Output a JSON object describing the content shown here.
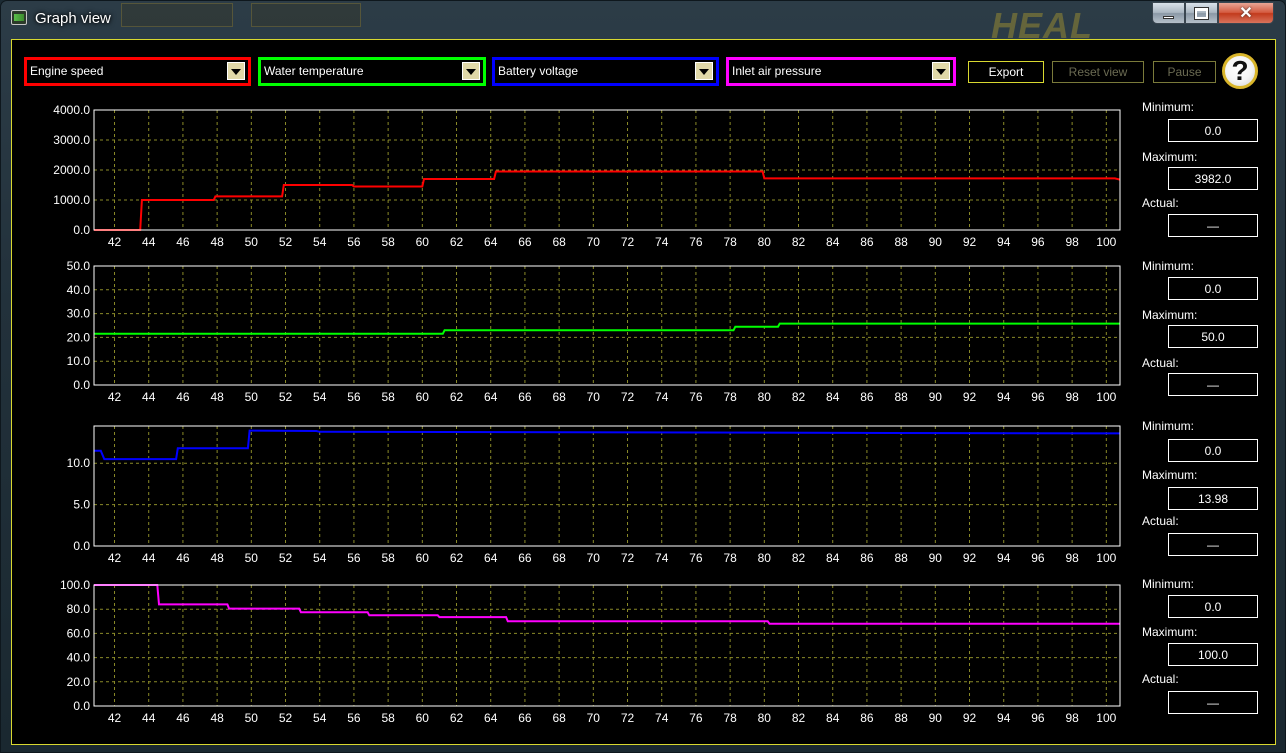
{
  "window": {
    "title": "Graph view",
    "brand_logo": "HEAL"
  },
  "toolbar": {
    "selects": [
      {
        "label": "Engine speed",
        "color": "#ff0000"
      },
      {
        "label": "Water temperature",
        "color": "#00ff00"
      },
      {
        "label": "Battery voltage",
        "color": "#0000ff"
      },
      {
        "label": "Inlet air pressure",
        "color": "#ff00ff"
      }
    ],
    "export_label": "Export",
    "reset_label": "Reset view",
    "pause_label": "Pause",
    "help_label": "?"
  },
  "side_labels": {
    "minimum": "Minimum:",
    "maximum": "Maximum:",
    "actual": "Actual:"
  },
  "panels": [
    {
      "minimum": "0.0",
      "maximum": "3982.0",
      "actual": "—"
    },
    {
      "minimum": "0.0",
      "maximum": "50.0",
      "actual": "—"
    },
    {
      "minimum": "0.0",
      "maximum": "13.98",
      "actual": "—"
    },
    {
      "minimum": "0.0",
      "maximum": "100.0",
      "actual": "—"
    }
  ],
  "chart_data": [
    {
      "type": "line",
      "series": [
        {
          "color": "#ff0000",
          "points": [
            [
              40.8,
              0
            ],
            [
              43.5,
              0
            ],
            [
              43.6,
              1000
            ],
            [
              47.8,
              1000
            ],
            [
              47.9,
              1120
            ],
            [
              51.8,
              1120
            ],
            [
              51.9,
              1500
            ],
            [
              55.9,
              1500
            ],
            [
              56.0,
              1450
            ],
            [
              60.0,
              1450
            ],
            [
              60.1,
              1700
            ],
            [
              64.2,
              1700
            ],
            [
              64.3,
              1950
            ],
            [
              79.9,
              1950
            ],
            [
              80.0,
              1720
            ],
            [
              100.5,
              1720
            ],
            [
              100.8,
              1680
            ]
          ]
        }
      ],
      "x_range": [
        40.8,
        100.8
      ],
      "y_range": [
        0,
        4000
      ],
      "y_ticks": [
        "0.0",
        "1000.0",
        "2000.0",
        "3000.0",
        "4000.0"
      ],
      "x_ticks": [
        "42",
        "44",
        "46",
        "48",
        "50",
        "52",
        "54",
        "56",
        "58",
        "60",
        "62",
        "64",
        "66",
        "68",
        "70",
        "72",
        "74",
        "76",
        "78",
        "80",
        "82",
        "84",
        "86",
        "88",
        "90",
        "92",
        "94",
        "96",
        "98",
        "100"
      ],
      "grid": true
    },
    {
      "type": "line",
      "series": [
        {
          "color": "#00ff00",
          "points": [
            [
              40.8,
              21.5
            ],
            [
              61.2,
              21.5
            ],
            [
              61.3,
              23.0
            ],
            [
              78.2,
              23.0
            ],
            [
              78.3,
              24.5
            ],
            [
              80.8,
              24.5
            ],
            [
              80.9,
              25.8
            ],
            [
              100.8,
              25.8
            ]
          ]
        }
      ],
      "x_range": [
        40.8,
        100.8
      ],
      "y_range": [
        0,
        50
      ],
      "y_ticks": [
        "0.0",
        "10.0",
        "20.0",
        "30.0",
        "40.0",
        "50.0"
      ],
      "x_ticks": [
        "42",
        "44",
        "46",
        "48",
        "50",
        "52",
        "54",
        "56",
        "58",
        "60",
        "62",
        "64",
        "66",
        "68",
        "70",
        "72",
        "74",
        "76",
        "78",
        "80",
        "82",
        "84",
        "86",
        "88",
        "90",
        "92",
        "94",
        "96",
        "98",
        "100"
      ],
      "grid": true
    },
    {
      "type": "line",
      "series": [
        {
          "color": "#0000ff",
          "points": [
            [
              40.8,
              11.5
            ],
            [
              41.2,
              11.5
            ],
            [
              41.4,
              10.5
            ],
            [
              45.6,
              10.5
            ],
            [
              45.7,
              11.8
            ],
            [
              49.8,
              11.8
            ],
            [
              49.9,
              13.95
            ],
            [
              53.8,
              13.9
            ],
            [
              54.0,
              13.8
            ],
            [
              100.8,
              13.6
            ]
          ]
        }
      ],
      "x_range": [
        40.8,
        100.8
      ],
      "y_range": [
        0,
        14.5
      ],
      "y_ticks": [
        "0.0",
        "5.0",
        "10.0"
      ],
      "x_ticks": [
        "42",
        "44",
        "46",
        "48",
        "50",
        "52",
        "54",
        "56",
        "58",
        "60",
        "62",
        "64",
        "66",
        "68",
        "70",
        "72",
        "74",
        "76",
        "78",
        "80",
        "82",
        "84",
        "86",
        "88",
        "90",
        "92",
        "94",
        "96",
        "98",
        "100"
      ],
      "grid": true
    },
    {
      "type": "line",
      "series": [
        {
          "color": "#ff00ff",
          "points": [
            [
              40.8,
              100
            ],
            [
              44.5,
              100
            ],
            [
              44.6,
              84
            ],
            [
              48.6,
              84
            ],
            [
              48.7,
              80.5
            ],
            [
              52.8,
              80.5
            ],
            [
              52.9,
              77.5
            ],
            [
              56.8,
              77.5
            ],
            [
              56.9,
              75
            ],
            [
              60.9,
              75
            ],
            [
              61.0,
              73.5
            ],
            [
              64.9,
              73.5
            ],
            [
              65.0,
              70
            ],
            [
              80.2,
              70
            ],
            [
              80.3,
              68
            ],
            [
              100.8,
              68
            ]
          ]
        }
      ],
      "x_range": [
        40.8,
        100.8
      ],
      "y_range": [
        0,
        100
      ],
      "y_ticks": [
        "0.0",
        "20.0",
        "40.0",
        "60.0",
        "80.0",
        "100.0"
      ],
      "x_ticks": [
        "42",
        "44",
        "46",
        "48",
        "50",
        "52",
        "54",
        "56",
        "58",
        "60",
        "62",
        "64",
        "66",
        "68",
        "70",
        "72",
        "74",
        "76",
        "78",
        "80",
        "82",
        "84",
        "86",
        "88",
        "90",
        "92",
        "94",
        "96",
        "98",
        "100"
      ],
      "grid": true
    }
  ]
}
